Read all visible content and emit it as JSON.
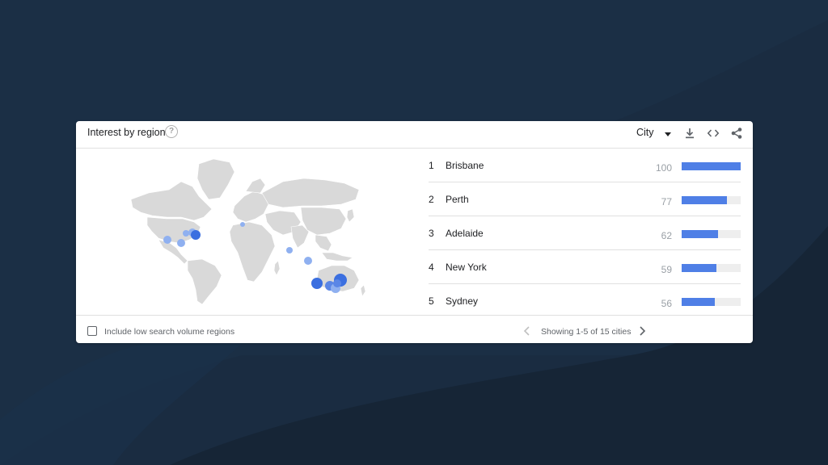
{
  "card": {
    "title": "Interest by region",
    "help_icon": "help-circle-icon",
    "resolution_dropdown": {
      "selected": "City"
    },
    "actions": [
      "download-icon",
      "embed-code-icon",
      "share-icon"
    ]
  },
  "map": {
    "description_icon": "world-map",
    "marker_colors": {
      "high": "#3b6fe0",
      "low": "#8fb0f0"
    }
  },
  "regions": [
    {
      "rank": "1",
      "name": "Brisbane",
      "score": "100",
      "value": 100
    },
    {
      "rank": "2",
      "name": "Perth",
      "score": "77",
      "value": 77
    },
    {
      "rank": "3",
      "name": "Adelaide",
      "score": "62",
      "value": 62
    },
    {
      "rank": "4",
      "name": "New York",
      "score": "59",
      "value": 59
    },
    {
      "rank": "5",
      "name": "Sydney",
      "score": "56",
      "value": 56
    }
  ],
  "footer": {
    "checkbox_label": "Include low search volume regions",
    "checkbox_checked": false,
    "pager_text": "Showing 1-5 of 15 cities"
  },
  "colors": {
    "background": "#1b2f45",
    "bar": "#4f7fe6",
    "bar_track": "#eeeeee"
  }
}
